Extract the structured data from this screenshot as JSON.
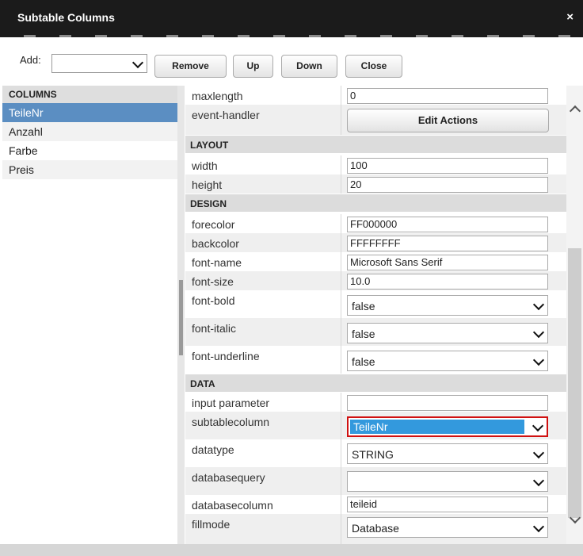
{
  "dialog": {
    "title": "Subtable Columns",
    "close_glyph": "×"
  },
  "toolbar": {
    "add_label": "Add:",
    "add_value": "",
    "buttons": [
      "Remove",
      "Up",
      "Down",
      "Close"
    ]
  },
  "columns_panel": {
    "header": "COLUMNS",
    "items": [
      "TeileNr",
      "Anzahl",
      "Farbe",
      "Preis"
    ],
    "selected": "TeileNr"
  },
  "properties": {
    "top": {
      "maxlength_label": "maxlength",
      "maxlength_value": "0",
      "event_handler_label": "event-handler",
      "edit_actions_label": "Edit Actions"
    },
    "layout": {
      "header": "LAYOUT",
      "width_label": "width",
      "width_value": "100",
      "height_label": "height",
      "height_value": "20"
    },
    "design": {
      "header": "DESIGN",
      "forecolor_label": "forecolor",
      "forecolor_value": "FF000000",
      "backcolor_label": "backcolor",
      "backcolor_value": "FFFFFFFF",
      "fontname_label": "font-name",
      "fontname_value": "Microsoft Sans Serif",
      "fontsize_label": "font-size",
      "fontsize_value": "10.0",
      "fontbold_label": "font-bold",
      "fontbold_value": "false",
      "fontitalic_label": "font-italic",
      "fontitalic_value": "false",
      "fontunderline_label": "font-underline",
      "fontunderline_value": "false"
    },
    "data": {
      "header": "DATA",
      "inputparam_label": "input parameter",
      "inputparam_value": "",
      "subtablecolumn_label": "subtablecolumn",
      "subtablecolumn_value": "TeileNr",
      "datatype_label": "datatype",
      "datatype_value": "STRING",
      "databasequery_label": "databasequery",
      "databasequery_value": "",
      "databasecolumn_label": "databasecolumn",
      "databasecolumn_value": "teileid",
      "fillmode_label": "fillmode",
      "fillmode_value": "Database"
    }
  },
  "colors": {
    "title_bg": "#1b1b1b",
    "selection": "#5b8ec2",
    "focus_border": "#d01010",
    "focus_fill": "#3399dd"
  }
}
